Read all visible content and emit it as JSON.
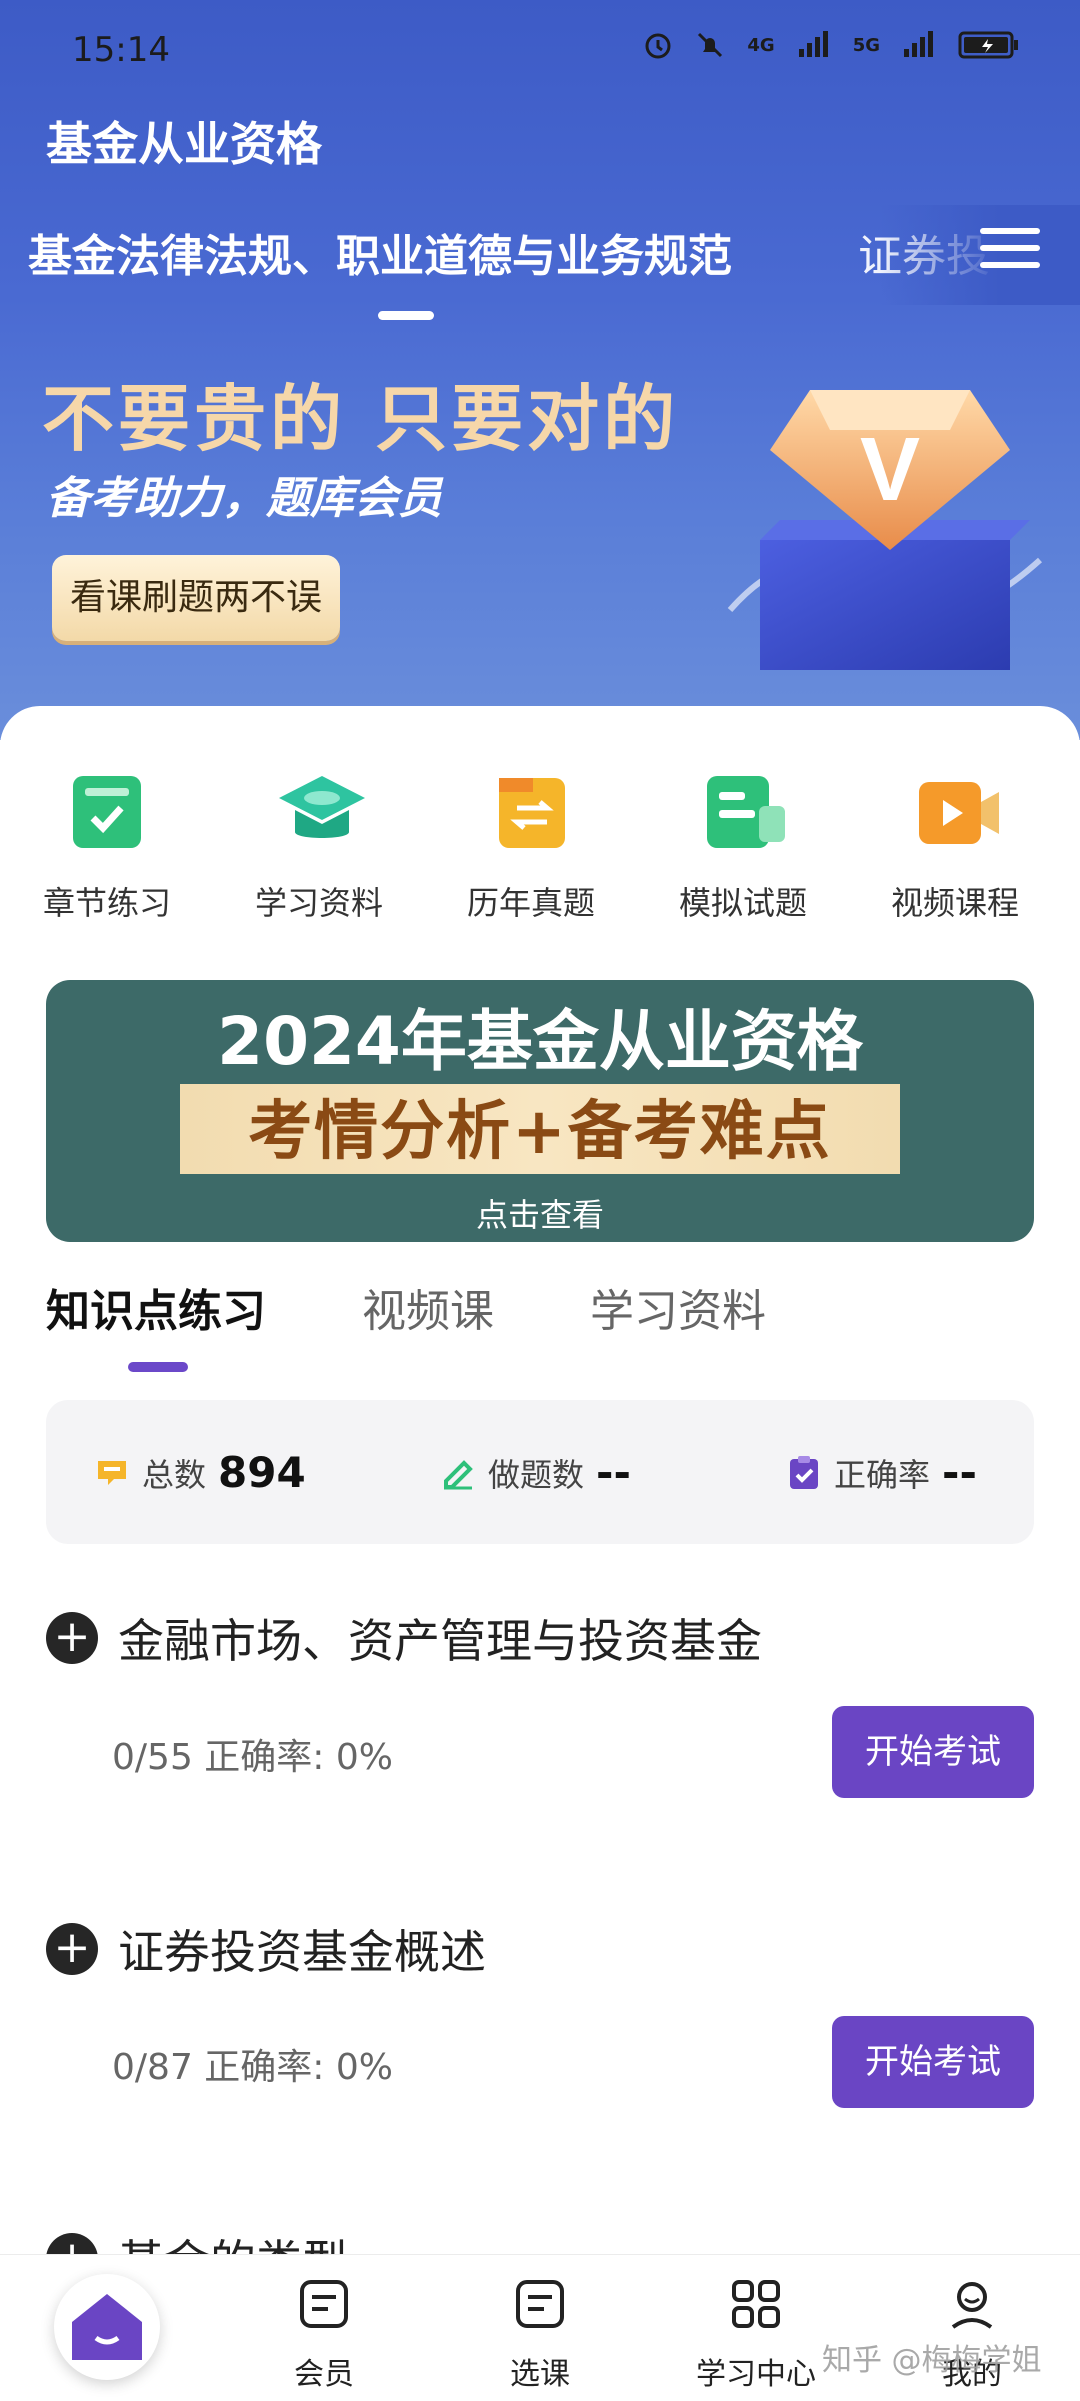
{
  "status_bar": {
    "time": "15:14",
    "net1": "4G",
    "net2": "5G"
  },
  "header": {
    "app_title": "基金从业资格",
    "subject_tabs": [
      "基金法律法规、职业道德与业务规范",
      "证券投"
    ]
  },
  "banner": {
    "headline": "不要贵的 只要对的",
    "subline": "备考助力，题库会员",
    "button": "看课刷题两不误",
    "badge_letter": "V"
  },
  "quick_actions": [
    {
      "label": "章节练习",
      "icon": "chapter-practice-icon",
      "color": "#2ec07a"
    },
    {
      "label": "学习资料",
      "icon": "graduation-cap-icon",
      "color": "#2ec4a0"
    },
    {
      "label": "历年真题",
      "icon": "past-exam-book-icon",
      "color": "#f5b52a"
    },
    {
      "label": "模拟试题",
      "icon": "mock-exam-icon",
      "color": "#2ec07a"
    },
    {
      "label": "视频课程",
      "icon": "video-course-icon",
      "color": "#f59a2a"
    }
  ],
  "promo": {
    "title": "2024年基金从业资格",
    "subtitle": "考情分析+备考难点",
    "cta": "点击查看"
  },
  "knowledge_tabs": [
    "知识点练习",
    "视频课",
    "学习资料"
  ],
  "stats": {
    "total_label": "总数",
    "total_value": "894",
    "done_label": "做题数",
    "done_value": "--",
    "accuracy_label": "正确率",
    "accuracy_value": "--"
  },
  "sections": [
    {
      "title": "金融市场、资产管理与投资基金",
      "meta": "0/55  正确率: 0%",
      "button": "开始考试"
    },
    {
      "title": "证券投资基金概述",
      "meta": "0/87  正确率: 0%",
      "button": "开始考试"
    },
    {
      "title": "基金的类型"
    }
  ],
  "bottom_nav": [
    "会员",
    "选课",
    "学习中心",
    "我的"
  ],
  "watermark": "知乎 @梅梅学姐"
}
